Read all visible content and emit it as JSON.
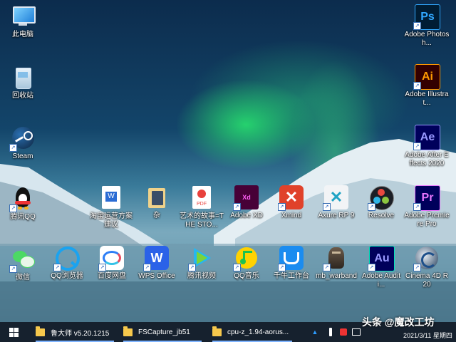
{
  "desktop": {
    "icons": [
      {
        "label": "此电脑",
        "icon": "computer-icon"
      },
      {
        "label": "回收站",
        "icon": "recycle-bin-icon"
      },
      {
        "label": "Steam",
        "icon": "steam-icon"
      },
      {
        "label": "腾讯QQ",
        "icon": "qq-penguin-icon"
      },
      {
        "label": "微信",
        "icon": "wechat-icon"
      },
      {
        "label": "Adobe Photosh...",
        "icon": "photoshop-icon"
      },
      {
        "label": "Adobe Illustrat...",
        "icon": "illustrator-icon"
      },
      {
        "label": "Adobe After Effects 2020",
        "icon": "after-effects-icon"
      },
      {
        "label": "Adobe Premiere Pro",
        "icon": "premiere-icon"
      },
      {
        "label": "Cinema 4D R20",
        "icon": "cinema4d-icon"
      },
      {
        "label": "淘宝运营方案建议",
        "icon": "word-doc-icon"
      },
      {
        "label": "杂",
        "icon": "folder-icon"
      },
      {
        "label": "艺术的故事=THE STO...",
        "icon": "pdf-icon"
      },
      {
        "label": "Adobe XD",
        "icon": "adobe-xd-icon"
      },
      {
        "label": "Xmind",
        "icon": "xmind-icon"
      },
      {
        "label": "Axure RP 9",
        "icon": "axure-icon"
      },
      {
        "label": "Resolve",
        "icon": "davinci-resolve-icon"
      },
      {
        "label": "QQ浏览器",
        "icon": "qq-browser-icon"
      },
      {
        "label": "百度网盘",
        "icon": "baidu-netdisk-icon"
      },
      {
        "label": "WPS Office",
        "icon": "wps-icon"
      },
      {
        "label": "腾讯视频",
        "icon": "tencent-video-icon"
      },
      {
        "label": "QQ音乐",
        "icon": "qq-music-icon"
      },
      {
        "label": "千牛工作台",
        "icon": "qianniu-icon"
      },
      {
        "label": "mb_warband",
        "icon": "warband-icon"
      },
      {
        "label": "Adobe Auditi...",
        "icon": "audition-icon"
      }
    ]
  },
  "taskbar": {
    "start_icon": "windows-logo-icon",
    "items": [
      {
        "label": "鲁大师 v5.20.1215"
      },
      {
        "label": "FSCapture_jb51"
      },
      {
        "label": "cpu-z_1.94-aorus..."
      }
    ],
    "watermark": "头条 @魔改工坊",
    "date": "2021/3/11 星期四"
  },
  "tile_text": {
    "ps": "Ps",
    "ai": "Ai",
    "ae": "Ae",
    "pr": "Pr",
    "au": "Au",
    "xd": "Xd",
    "pdf": "PDF",
    "wps": "W"
  }
}
